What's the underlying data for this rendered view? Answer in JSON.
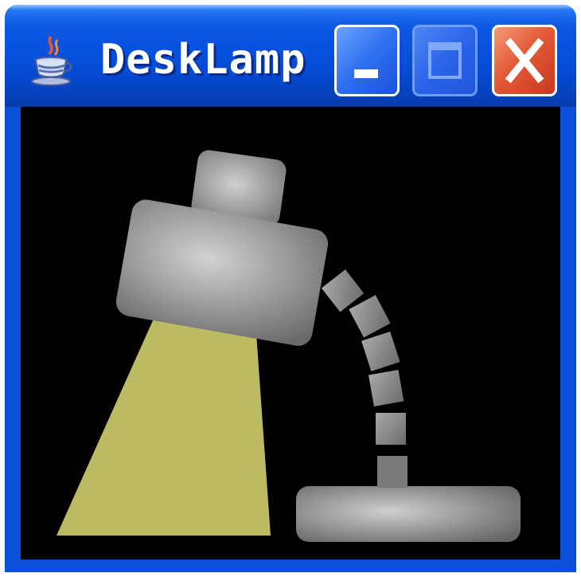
{
  "window": {
    "title": "DeskLamp",
    "app_icon": "java-coffee-cup-icon",
    "controls": {
      "minimize_icon": "minimize-icon",
      "maximize_icon": "maximize-icon",
      "close_icon": "close-icon"
    },
    "colors": {
      "titlebar": "#0652de",
      "close_button": "#e35a36",
      "canvas_background": "#000000",
      "lamp_metal": "#a0a0a0",
      "light_beam": "#bcba62"
    }
  },
  "scene": {
    "description_icons": [
      "lamp-shade",
      "lamp-cap",
      "light-beam",
      "lamp-arm",
      "lamp-base"
    ]
  }
}
